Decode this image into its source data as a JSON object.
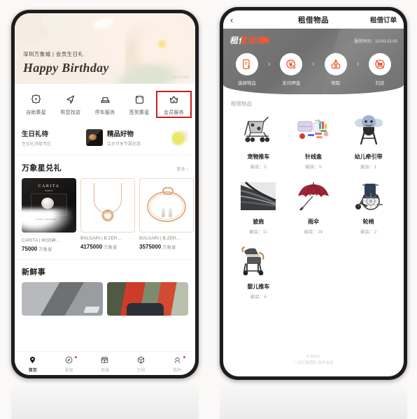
{
  "left_phone": {
    "banner": {
      "subtitle": "深圳万象城 | 会员生日礼",
      "title": "Happy Birthday",
      "corner_note": "图片仅供参考"
    },
    "quick_actions": [
      {
        "label": "自助集星",
        "icon": "star-badge-icon",
        "selected": false
      },
      {
        "label": "帮您找店",
        "icon": "navigation-cursor-icon",
        "selected": false
      },
      {
        "label": "停车服务",
        "icon": "car-icon",
        "selected": false
      },
      {
        "label": "签到集星",
        "icon": "calendar-icon",
        "selected": false
      },
      {
        "label": "会员服务",
        "icon": "crown-icon",
        "selected": true
      }
    ],
    "promos": [
      {
        "title": "生日礼待",
        "subtitle": "生日礼领取专区",
        "thumb": "gift-box-thumb"
      },
      {
        "title": "精品好物",
        "subtitle": "会员可享专属优惠",
        "thumb": "bottle-thumb"
      }
    ],
    "points_section": {
      "title": "万象星兑礼",
      "more": "更多 ›",
      "products": [
        {
          "name": "CARITA | 90分钟…",
          "price": "75000",
          "unit": "万象星",
          "image": "carita-package"
        },
        {
          "name": "BVLGARI | B.ZER…",
          "price": "4175000",
          "unit": "万象星",
          "image": "bvlgari-necklace"
        },
        {
          "name": "BVLGARI | B.ZER…",
          "price": "3575000",
          "unit": "万象星",
          "image": "bvlgari-bracelet"
        }
      ]
    },
    "news_section": {
      "title": "新鲜事"
    },
    "tabbar": [
      {
        "label": "首页",
        "icon": "home-pin-icon",
        "active": true,
        "badge": false
      },
      {
        "label": "发现",
        "icon": "compass-icon",
        "active": false,
        "badge": true
      },
      {
        "label": "商城",
        "icon": "shop-icon",
        "active": false,
        "badge": false
      },
      {
        "label": "空间",
        "icon": "cube-icon",
        "active": false,
        "badge": false
      },
      {
        "label": "我的",
        "icon": "person-icon",
        "active": false,
        "badge": true
      }
    ]
  },
  "right_phone": {
    "nav": {
      "back": "‹",
      "title": "租借物品",
      "right_action": "租借订单"
    },
    "flow": {
      "badge": "租借流程",
      "service_time_label": "服务时间：",
      "service_time": "10:00-22:00",
      "arrow": "›",
      "steps": [
        {
          "label": "选择物品",
          "icon": "phone-select-icon"
        },
        {
          "label": "支付押金",
          "icon": "yen-check-icon"
        },
        {
          "label": "领取",
          "icon": "pickup-person-icon"
        },
        {
          "label": "归还",
          "icon": "return-icon"
        }
      ]
    },
    "goods": {
      "section_title": "租借物品",
      "stock_prefix": "剩余：",
      "items": [
        {
          "name": "宠物推车",
          "stock": "5",
          "image": "pet-stroller"
        },
        {
          "name": "针线盒",
          "stock": "5",
          "image": "sewing-kit"
        },
        {
          "name": "幼儿牵引带",
          "stock": "1",
          "image": "toddler-harness"
        },
        {
          "name": "披肩",
          "stock": "11",
          "image": "shawl"
        },
        {
          "name": "雨伞",
          "stock": "29",
          "image": "umbrella"
        },
        {
          "name": "轮椅",
          "stock": "2",
          "image": "wheelchair"
        },
        {
          "name": "婴儿推车",
          "stock": "6",
          "image": "baby-stroller"
        }
      ]
    },
    "footer": {
      "brand": "E-MIXC",
      "credit": "一点万象团队 技术支持"
    }
  },
  "colors": {
    "accent_red": "#cf1c1c",
    "orange": "#ef5a33",
    "flow_grey": "#757575",
    "gold": "#e3b083"
  }
}
